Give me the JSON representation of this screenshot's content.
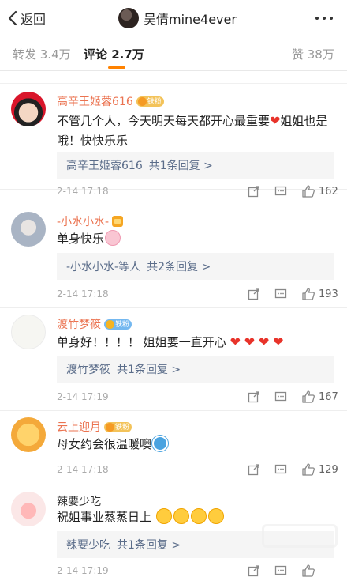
{
  "nav": {
    "back_label": "返回",
    "title": "吴倩mine4ever"
  },
  "tabs": {
    "repost": "转发 3.4万",
    "comments": "评论 2.7万",
    "likes": "赞 38万"
  },
  "colors": {
    "accent": "#ff8200",
    "username": "#eb7350",
    "link": "#5b6d8a"
  },
  "comments": [
    {
      "user": "高辛王姬蓉616",
      "badge": "铁粉",
      "text": "不管几个人，今天明天每天都开心最重要",
      "text_after_emoji": "姐姐也是哦！快快乐乐",
      "reply_user": "高辛王姬蓉616",
      "reply_more": "共1条回复 >",
      "time": "2-14 17:18",
      "likes": "162"
    },
    {
      "user": "-小水小水-",
      "badge": "",
      "text": "单身快乐",
      "reply_user": "-小水小水-等人",
      "reply_more": "共2条回复 >",
      "time": "2-14 17:18",
      "likes": "193"
    },
    {
      "user": "渡竹梦筱",
      "badge": "铁粉",
      "text": "单身好！！！！ 姐姐要一直开心",
      "reply_user": "渡竹梦筱",
      "reply_more": "共1条回复 >",
      "time": "2-14 17:19",
      "likes": "167"
    },
    {
      "user": "云上迎月",
      "badge": "铁粉",
      "text": "母女约会很温暖噢",
      "time": "2-14 17:18",
      "likes": "129"
    },
    {
      "user": "辣要少吃",
      "badge": "",
      "text": "祝姐事业蒸蒸日上",
      "reply_user": "辣要少吃",
      "reply_more": "共1条回复 >",
      "time": "2-14 17:19",
      "likes": ""
    }
  ],
  "icons": [
    "chevron-left-icon",
    "more-icon",
    "share-icon",
    "comment-icon",
    "like-icon",
    "heart-emoji",
    "pig-emoji",
    "doraemon-emoji",
    "crying-emoji"
  ]
}
